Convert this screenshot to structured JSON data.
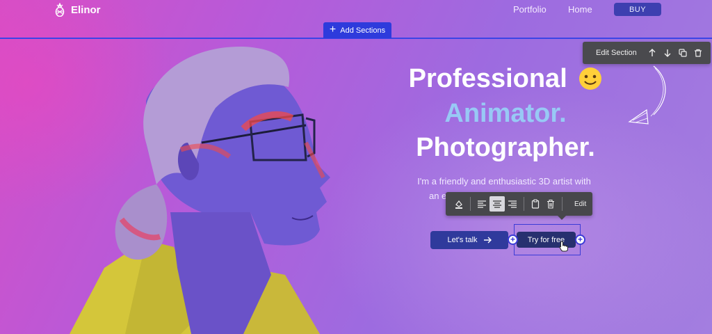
{
  "header": {
    "brand": "Elinor",
    "nav": [
      {
        "label": "Portfolio"
      },
      {
        "label": "Home"
      }
    ],
    "buy_label": "BUY"
  },
  "editor": {
    "add_sections_label": "Add Sections",
    "edit_section_label": "Edit Section",
    "element_toolbar_edit_label": "Edit"
  },
  "hero": {
    "line1": "Professional",
    "line2": "Animator.",
    "line3": "Photographer.",
    "description_line1": "I'm a friendly and enthusiastic 3D artist with",
    "description_line2": "an eye for detail. I love ... f ... imation,",
    "cta_primary": "Let's talk",
    "cta_secondary": "Try for free"
  },
  "colors": {
    "accent": "#2e3bdc",
    "toolbar_bg": "#4a4a4e",
    "highlight_text": "#98c9f5",
    "button_primary": "#2f3a9c",
    "button_secondary": "#27306f"
  },
  "icons": [
    "pineapple-logo-icon",
    "plus-icon",
    "arrow-up-icon",
    "arrow-down-icon",
    "duplicate-icon",
    "trash-icon",
    "fill-color-icon",
    "align-left-icon",
    "align-center-icon",
    "align-right-icon",
    "clipboard-icon",
    "arrow-right-icon",
    "cursor-hand-icon",
    "smiley-emoji-icon"
  ]
}
